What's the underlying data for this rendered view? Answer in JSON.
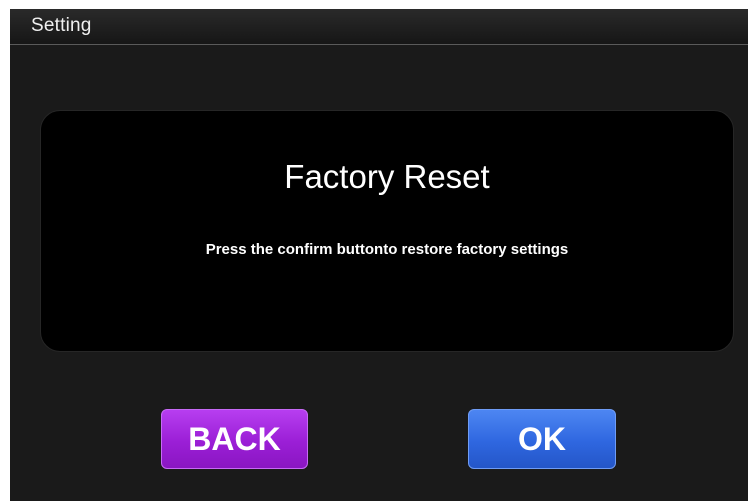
{
  "window": {
    "title": "Setting"
  },
  "dialog": {
    "title": "Factory Reset",
    "message": "Press the confirm buttonto restore factory settings"
  },
  "buttons": {
    "back_label": "BACK",
    "ok_label": "OK"
  },
  "colors": {
    "background": "#1a1a1a",
    "dialog_background": "#000000",
    "back_button": "#9b1fd6",
    "ok_button": "#2f67e0",
    "text": "#ffffff"
  }
}
